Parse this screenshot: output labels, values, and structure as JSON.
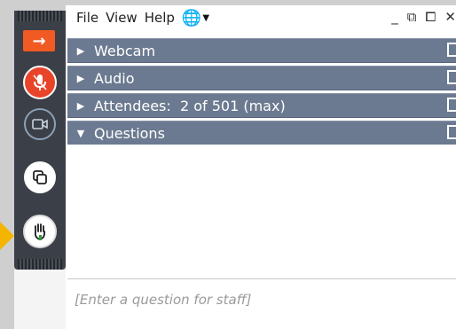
{
  "menu": {
    "file": "File",
    "view": "View",
    "help": "Help"
  },
  "icons": {
    "globe": "globe-icon",
    "collapse": "arrow-right-icon",
    "mic": "microphone-icon",
    "camera": "camera-icon",
    "share": "screen-share-icon",
    "hand": "raise-hand-icon"
  },
  "window_controls": {
    "minimize": "_",
    "restore": "⧉",
    "popout": "⧠",
    "close": "✕"
  },
  "sections": [
    {
      "id": "webcam",
      "label": "Webcam",
      "expanded": false
    },
    {
      "id": "audio",
      "label": "Audio",
      "expanded": false
    },
    {
      "id": "attendees",
      "label": "Attendees:  2 of 501 (max)",
      "expanded": false
    },
    {
      "id": "questions",
      "label": "Questions",
      "expanded": true
    }
  ],
  "questions": {
    "placeholder": "[Enter a question for staff]"
  },
  "colors": {
    "toolbar": "#3b3f47",
    "accent_orange": "#f15a22",
    "mic_red": "#e8442a",
    "section_header": "#6b7a90",
    "pointer_yellow": "#f4b400"
  }
}
